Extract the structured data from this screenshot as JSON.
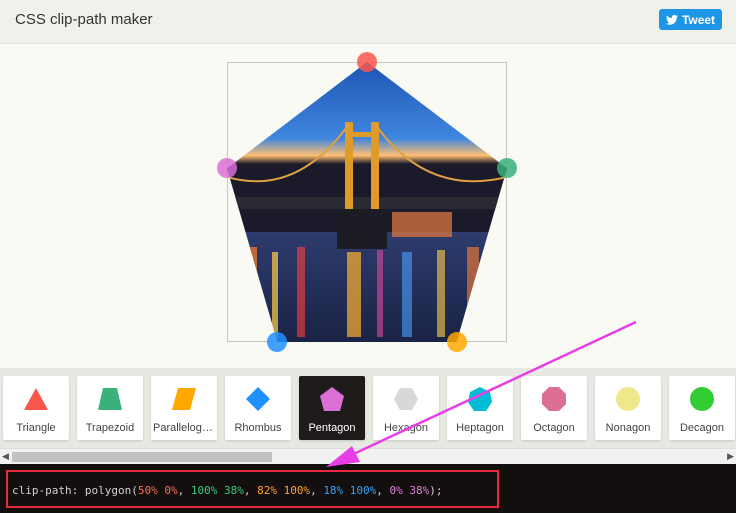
{
  "header": {
    "title": "CSS clip-path maker",
    "tweet_label": "Tweet"
  },
  "shapes": [
    {
      "label": "Triangle",
      "color": "#f9574c"
    },
    {
      "label": "Trapezoid",
      "color": "#3ab07a"
    },
    {
      "label": "Parallelogram",
      "color": "#ffa800"
    },
    {
      "label": "Rhombus",
      "color": "#1e90ff"
    },
    {
      "label": "Pentagon",
      "color": "#da70d6",
      "active": true
    },
    {
      "label": "Hexagon",
      "color": "#d8d8d8"
    },
    {
      "label": "Heptagon",
      "color": "#00bcd4"
    },
    {
      "label": "Octagon",
      "color": "#db7093"
    },
    {
      "label": "Nonagon",
      "color": "#f0e68c"
    },
    {
      "label": "Decagon",
      "color": "#32cd32"
    }
  ],
  "code": {
    "prop": "clip-path:",
    "fn": "polygon(",
    "p1": "50% 0%",
    "p2": "100% 38%",
    "p3": "82% 100%",
    "p4": "18% 100%",
    "p5": "0% 38%",
    "close": ");"
  },
  "handle_colors": [
    "#f9574c",
    "#3ab07a",
    "#ffa800",
    "#1e90ff",
    "#da70d6"
  ]
}
